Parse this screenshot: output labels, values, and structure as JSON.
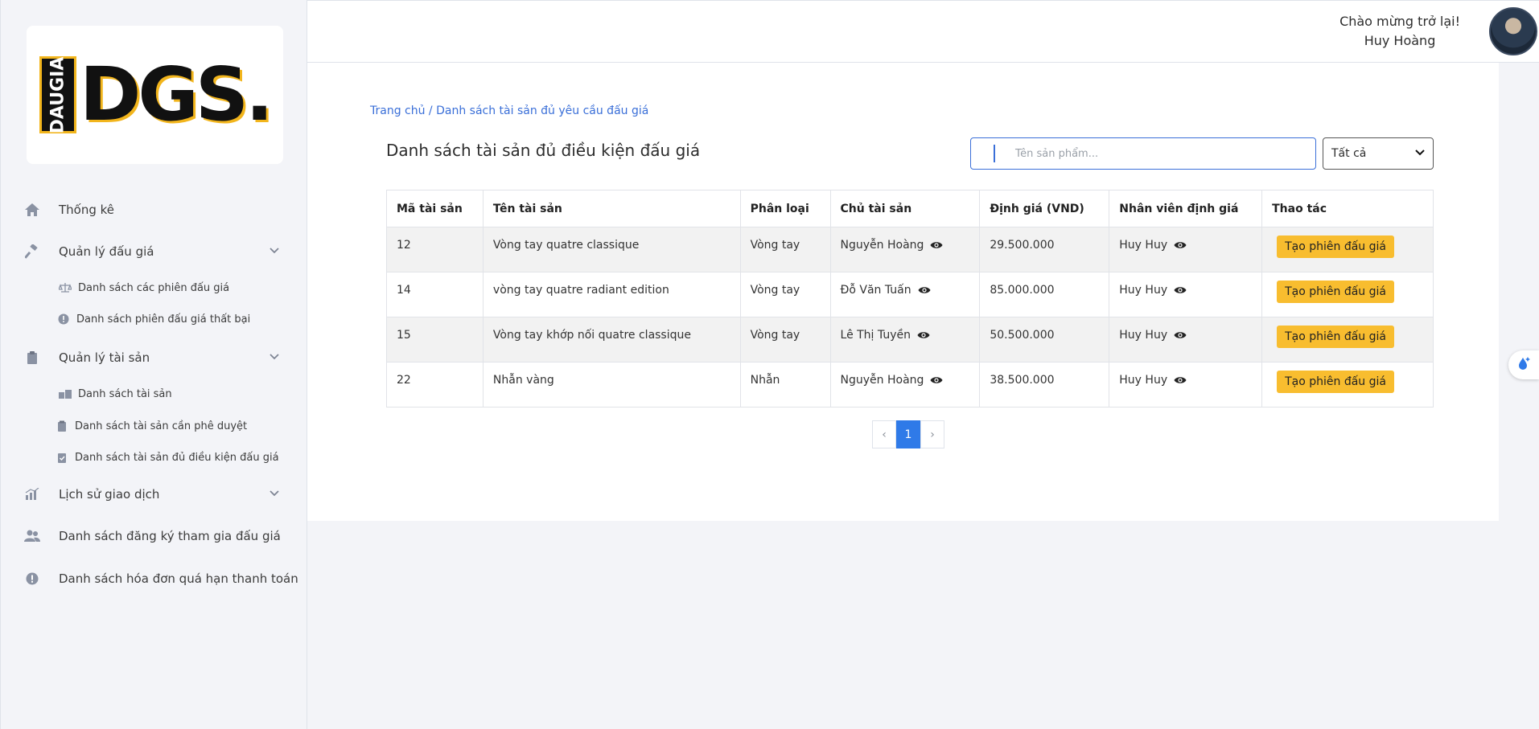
{
  "sidebar": {
    "logo_vertical": "DAUGIA",
    "logo_big": "DGS.",
    "items": [
      {
        "label": "Thống kê",
        "icon": "home-icon"
      },
      {
        "label": "Quản lý đấu giá",
        "icon": "gavel-icon"
      },
      {
        "label": "Danh sách các phiên đấu giá",
        "icon": "scale-icon"
      },
      {
        "label": "Danh sách phiên đấu giá thất bại",
        "icon": "alert-circle-icon"
      },
      {
        "label": "Quản lý tài sản",
        "icon": "clipboard-icon"
      },
      {
        "label": "Danh sách tài sản",
        "icon": "boxes-icon"
      },
      {
        "label": "Danh sách tài sản cần phê duyệt",
        "icon": "clipboard-icon"
      },
      {
        "label": "Danh sách tài sản đủ điều kiện đấu giá",
        "icon": "clipboard-check-icon"
      },
      {
        "label": "Lịch sử giao dịch",
        "icon": "chart-icon"
      },
      {
        "label": "Danh sách đăng ký tham gia đấu giá",
        "icon": "users-icon"
      },
      {
        "label": "Danh sách hóa đơn quá hạn thanh toán",
        "icon": "alert-circle-icon"
      }
    ]
  },
  "header": {
    "welcome": "Chào mừng trở lại!",
    "user_name": "Huy Hoàng"
  },
  "main": {
    "breadcrumb": "Trang chủ / Danh sách tài sản đủ yêu cầu đấu giá",
    "title": "Danh sách tài sản đủ điều kiện đấu giá",
    "search_placeholder": "Tên sản phẩm...",
    "filter_value": "Tất cả",
    "columns": [
      "Mã tài sản",
      "Tên tài sản",
      "Phân loại",
      "Chủ tài sản",
      "Định giá (VND)",
      "Nhân viên định giá",
      "Thao tác"
    ],
    "rows": [
      {
        "id": "12",
        "name": "Vòng tay quatre classique",
        "category": "Vòng tay",
        "owner": "Nguyễn Hoàng",
        "price": "29.500.000",
        "appraiser": "Huy Huy",
        "action": "Tạo phiên đấu giá"
      },
      {
        "id": "14",
        "name": "vòng tay quatre radiant edition",
        "category": "Vòng tay",
        "owner": "Đỗ Văn Tuấn",
        "price": "85.000.000",
        "appraiser": "Huy Huy",
        "action": "Tạo phiên đấu giá"
      },
      {
        "id": "15",
        "name": "Vòng tay khớp nối quatre classique",
        "category": "Vòng tay",
        "owner": "Lê Thị Tuyền",
        "price": "50.500.000",
        "appraiser": "Huy Huy",
        "action": "Tạo phiên đấu giá"
      },
      {
        "id": "22",
        "name": "Nhẫn vàng",
        "category": "Nhẫn",
        "owner": "Nguyễn Hoàng",
        "price": "38.500.000",
        "appraiser": "Huy Huy",
        "action": "Tạo phiên đấu giá"
      }
    ],
    "pagination": {
      "prev": "‹",
      "current": "1",
      "next": "›"
    }
  },
  "colors": {
    "accent": "#2f7ae8",
    "button": "#f8bd2f",
    "logo_yellow": "#f2b51c"
  }
}
